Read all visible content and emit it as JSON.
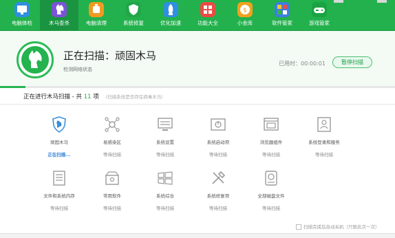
{
  "toolbar": {
    "items": [
      {
        "label": "电脑体检",
        "icon": "monitor-icon",
        "color": "#2f8fe0"
      },
      {
        "label": "木马查杀",
        "icon": "horse-icon",
        "color": "#7b52d8"
      },
      {
        "label": "电脑清理",
        "icon": "broom-icon",
        "color": "#f09a23"
      },
      {
        "label": "系统修复",
        "icon": "shield-icon",
        "color": "#21a64a"
      },
      {
        "label": "优化加速",
        "icon": "rocket-icon",
        "color": "#2f8fe0"
      },
      {
        "label": "功能大全",
        "icon": "grid-icon",
        "color": "#e94c44"
      },
      {
        "label": "小金库",
        "icon": "coin-icon",
        "color": "#f0a21f"
      },
      {
        "label": "软件管家",
        "icon": "apps-icon",
        "color": "#3b7fe0"
      },
      {
        "label": "游戏管家",
        "icon": "gamepad-icon",
        "color": "#19a342"
      }
    ],
    "active_index": 1
  },
  "scan": {
    "title": "正在扫描：顽固木马",
    "subtitle": "检测网络状态",
    "elapsed": "已用时：00:00:01",
    "pause_label": "暂停扫描",
    "progress": 0.065
  },
  "status": {
    "prefix": "正在进行木马扫描 - 共 ",
    "count": "11",
    "suffix": " 项",
    "hint": "（扫描系统是否存在病毒木马）"
  },
  "items": [
    {
      "name": "顽固木马",
      "state": "正在扫描...",
      "icon": "shield-horse-icon"
    },
    {
      "name": "易感染区",
      "state": "等待扫描",
      "icon": "virus-icon"
    },
    {
      "name": "系统设置",
      "state": "等待扫描",
      "icon": "settings-icon"
    },
    {
      "name": "系统启动项",
      "state": "等待扫描",
      "icon": "startup-icon"
    },
    {
      "name": "浏览器组件",
      "state": "等待扫描",
      "icon": "browser-icon"
    },
    {
      "name": "系统登录和服务",
      "state": "等待扫描",
      "icon": "user-service-icon"
    },
    {
      "name": "文件和系统内存",
      "state": "等待扫描",
      "icon": "file-memory-icon"
    },
    {
      "name": "常用软件",
      "state": "等待扫描",
      "icon": "software-icon"
    },
    {
      "name": "系统综合",
      "state": "等待扫描",
      "icon": "windows-icon"
    },
    {
      "name": "系统修复项",
      "state": "等待扫描",
      "icon": "tools-icon"
    },
    {
      "name": "全部磁盘文件",
      "state": "等待扫描",
      "icon": "disk-icon"
    }
  ],
  "bottom": {
    "option_label": "扫描完成后自动关机（只限此次一次）"
  }
}
